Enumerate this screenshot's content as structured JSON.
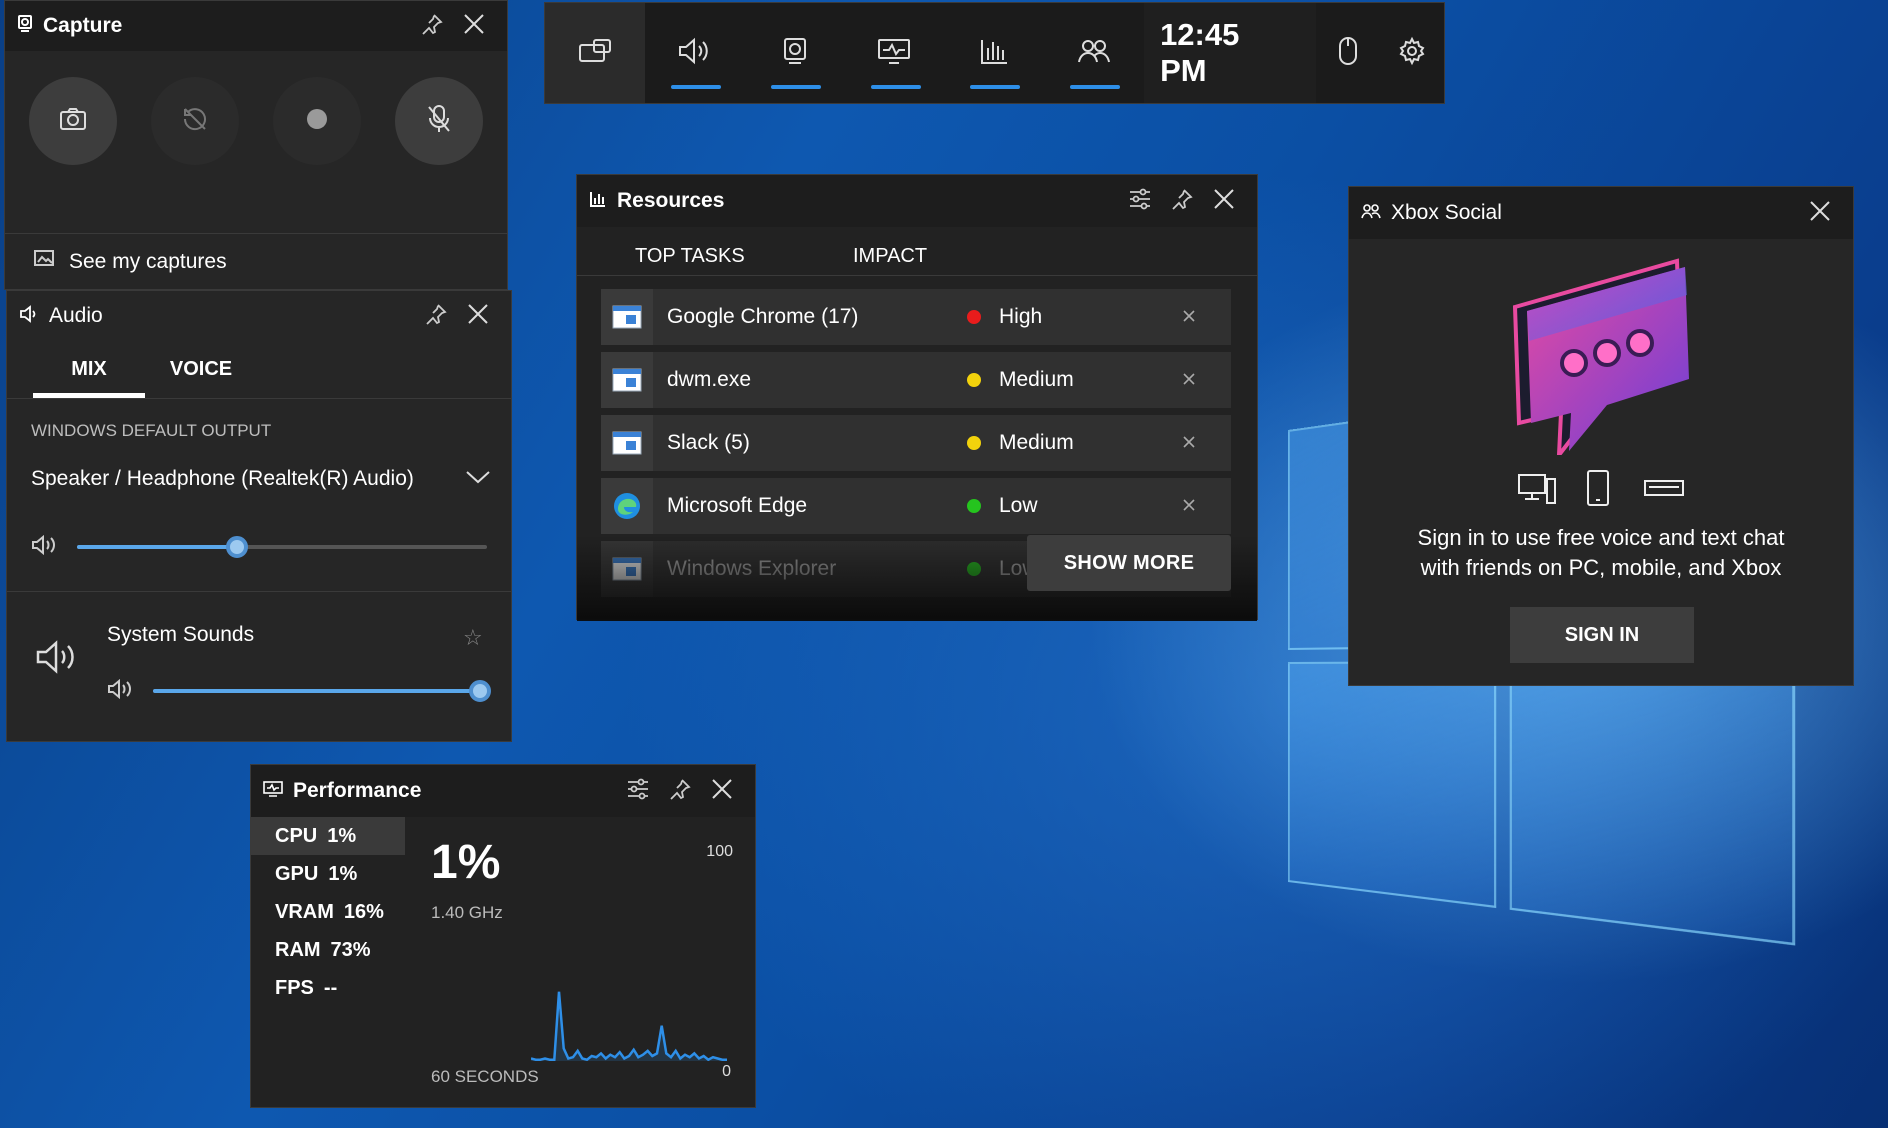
{
  "topbar": {
    "clock": "12:45 PM",
    "icons": [
      "widget-menu-icon",
      "audio-icon",
      "capture-icon",
      "performance-icon",
      "resources-icon",
      "xbox-social-icon",
      "mouse-icon",
      "gear-icon"
    ]
  },
  "capture": {
    "title": "Capture",
    "see_captures": "See my captures"
  },
  "audio": {
    "title": "Audio",
    "tabs": [
      "MIX",
      "VOICE"
    ],
    "output_heading": "WINDOWS DEFAULT OUTPUT",
    "device": "Speaker / Headphone (Realtek(R) Audio)",
    "master_volume": 0.39,
    "app_name": "System Sounds",
    "app_volume": 0.98
  },
  "resources": {
    "title": "Resources",
    "col_tasks": "TOP TASKS",
    "col_impact": "IMPACT",
    "rows": [
      {
        "name": "Google Chrome (17)",
        "impact": "High",
        "color": "#e81c1c"
      },
      {
        "name": "dwm.exe",
        "impact": "Medium",
        "color": "#f2d20c"
      },
      {
        "name": "Slack (5)",
        "impact": "Medium",
        "color": "#f2d20c"
      },
      {
        "name": "Microsoft Edge",
        "impact": "Low",
        "color": "#25c41e"
      },
      {
        "name": "Windows Explorer",
        "impact": "Low",
        "color": "#25c41e"
      }
    ],
    "show_more": "SHOW MORE"
  },
  "social": {
    "title": "Xbox Social",
    "message_line1": "Sign in to use free voice and text chat",
    "message_line2": "with friends on PC, mobile, and Xbox",
    "sign_in": "SIGN IN"
  },
  "performance": {
    "title": "Performance",
    "metrics": [
      {
        "label": "CPU",
        "value": "1%"
      },
      {
        "label": "GPU",
        "value": "1%"
      },
      {
        "label": "VRAM",
        "value": "16%"
      },
      {
        "label": "RAM",
        "value": "73%"
      },
      {
        "label": "FPS",
        "value": "--"
      }
    ],
    "big_value": "1%",
    "clock_speed": "1.40 GHz",
    "y_max": "100",
    "y_min": "0",
    "x_label": "60 SECONDS",
    "cpu_history": [
      2,
      1,
      1,
      2,
      1,
      1,
      55,
      10,
      2,
      3,
      8,
      2,
      1,
      4,
      3,
      6,
      2,
      5,
      3,
      7,
      2,
      4,
      9,
      3,
      5,
      8,
      4,
      6,
      28,
      6,
      3,
      8,
      2,
      5,
      3,
      6,
      2,
      4,
      1,
      3,
      2,
      1,
      1
    ]
  }
}
